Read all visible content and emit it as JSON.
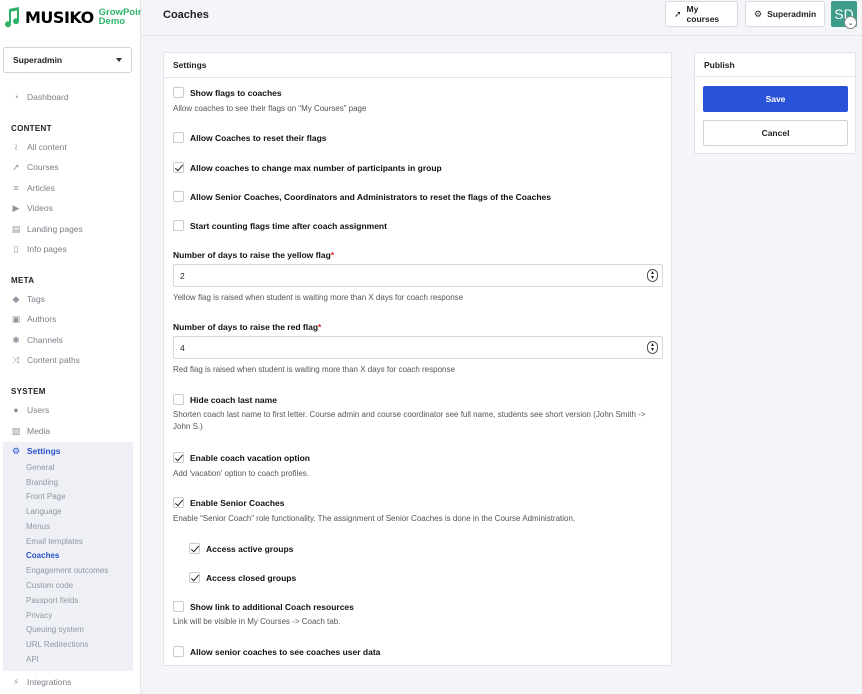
{
  "brand": {
    "name": "MUSIKO",
    "sub_line1": "GrowPoint",
    "sub_line2": "Demo",
    "accent": "#2db26a"
  },
  "role_select": {
    "value": "Superadmin"
  },
  "nav": {
    "dashboard": "Dashboard",
    "content_header": "CONTENT",
    "content_items": [
      "All content",
      "Courses",
      "Articles",
      "Videos",
      "Landing pages",
      "Info pages"
    ],
    "meta_header": "META",
    "meta_items": [
      "Tags",
      "Authors",
      "Channels",
      "Content paths"
    ],
    "system_header": "SYSTEM",
    "system_items": [
      "Users",
      "Media",
      "Settings"
    ],
    "settings_sub": [
      "General",
      "Branding",
      "Front Page",
      "Language",
      "Menus",
      "Email templates",
      "Coaches",
      "Engagement outcomes",
      "Custom code",
      "Passport fields",
      "Privacy",
      "Queuing system",
      "URL Redirections",
      "API"
    ],
    "active_sub": "Coaches",
    "integrations": "Integrations"
  },
  "topbar": {
    "title": "Coaches",
    "my_courses": "My courses",
    "superadmin": "Superadmin",
    "avatar": "SD"
  },
  "settings": {
    "title": "Settings",
    "show_flags": {
      "label": "Show flags to coaches",
      "checked": false,
      "help": "Allow coaches to see their flags on “My Courses” page"
    },
    "reset_flags": {
      "label": "Allow Coaches to reset their flags",
      "checked": false
    },
    "change_max": {
      "label": "Allow coaches to change max number of participants in group",
      "checked": true
    },
    "senior_reset": {
      "label": "Allow Senior Coaches, Coordinators and Administrators to reset the flags of the Coaches",
      "checked": false
    },
    "start_counting": {
      "label": "Start counting flags time after coach assignment",
      "checked": false
    },
    "yellow": {
      "label": "Number of days to raise the yellow flag",
      "required": "*",
      "value": "2",
      "help": "Yellow flag is raised when student is waiting more than X days for coach response"
    },
    "red": {
      "label": "Number of days to raise the red flag",
      "required": "*",
      "value": "4",
      "help": "Red flag is raised when student is waiting more than X days for coach response"
    },
    "hide_last": {
      "label": "Hide coach last name",
      "checked": false,
      "help": "Shorten coach last name to first letter. Course admin and course coordinator see full name, students see short version (John Smith -> John S.)"
    },
    "vacation": {
      "label": "Enable coach vacation option",
      "checked": true,
      "help": "Add 'vacation' option to coach profiles."
    },
    "senior": {
      "label": "Enable Senior Coaches",
      "checked": true,
      "help": "Enable “Senior Coach” role functionality. The assignment of Senior Coaches is done in the Course Administration."
    },
    "active_groups": {
      "label": "Access active groups",
      "checked": true
    },
    "closed_groups": {
      "label": "Access closed groups",
      "checked": true
    },
    "resources": {
      "label": "Show link to additional Coach resources",
      "checked": false,
      "help": "Link will be visible in My Courses -> Coach tab."
    },
    "senior_user_data": {
      "label": "Allow senior coaches to see coaches user data",
      "checked": false
    }
  },
  "publish": {
    "title": "Publish",
    "save": "Save",
    "cancel": "Cancel",
    "save_color": "#2a52d8"
  }
}
